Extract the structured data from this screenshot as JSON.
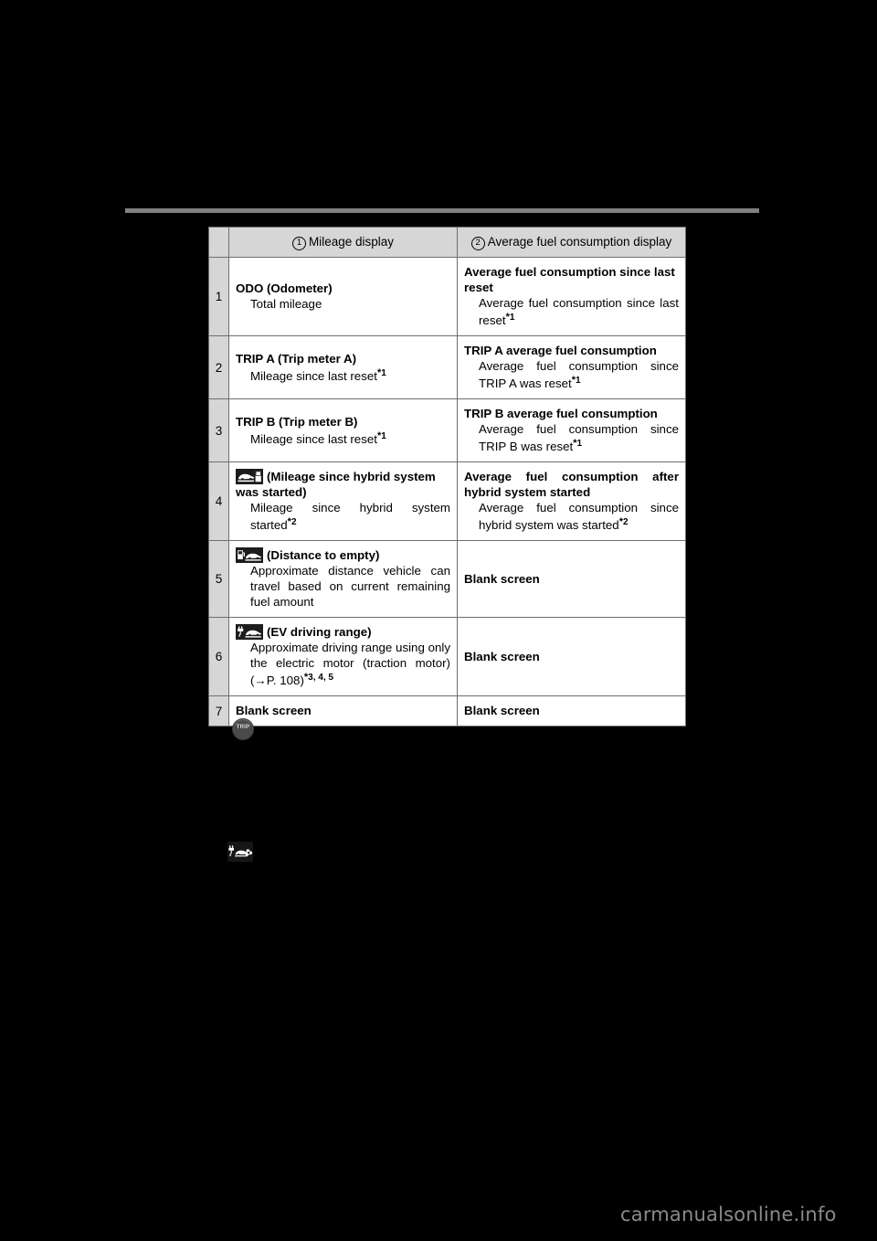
{
  "document": {
    "background_color": "#000000",
    "rule_color": "#808080"
  },
  "table": {
    "header": {
      "index_label": "",
      "col1_marker": "1",
      "col1_label": "Mileage display",
      "col2_marker": "2",
      "col2_label": "Average fuel consumption display"
    },
    "rows": [
      {
        "num": "1",
        "left": {
          "icon": null,
          "title": "ODO (Odometer)",
          "desc": "Total mileage",
          "footnote": ""
        },
        "right": {
          "title": "Average fuel consumption since last reset",
          "desc": "Average fuel consumption since last reset",
          "footnote": "1"
        }
      },
      {
        "num": "2",
        "left": {
          "icon": null,
          "title": "TRIP A (Trip meter A)",
          "desc": "Mileage since last reset",
          "footnote": "1"
        },
        "right": {
          "title": "TRIP A average fuel consumption",
          "desc": "Average fuel consumption since TRIP A was reset",
          "footnote": "1"
        }
      },
      {
        "num": "3",
        "left": {
          "icon": null,
          "title": "TRIP B (Trip meter B)",
          "desc": "Mileage since last reset",
          "footnote": "1"
        },
        "right": {
          "title": "TRIP B average fuel consumption",
          "desc": "Average fuel consumption since TRIP B was reset",
          "footnote": "1"
        }
      },
      {
        "num": "4",
        "left": {
          "icon": "car-mileage-icon",
          "title": "(Mileage since hybrid system was started)",
          "desc": "Mileage since hybrid system started",
          "footnote": "2"
        },
        "right": {
          "title": "Average fuel consumption after hybrid system started",
          "desc": "Average fuel consumption since hybrid system was started",
          "footnote": "2"
        }
      },
      {
        "num": "5",
        "left": {
          "icon": "fuel-pump-car-icon",
          "title": "(Distance to empty)",
          "desc": "Approximate distance vehicle can travel based on current remaining fuel amount",
          "footnote": ""
        },
        "right": {
          "title": "Blank screen",
          "desc": "",
          "footnote": ""
        }
      },
      {
        "num": "6",
        "left": {
          "icon": "ev-plug-car-icon",
          "title": "(EV driving range)",
          "desc": "Approximate driving range using only the electric motor (traction motor) (→P. 108)",
          "footnote": "3, 4, 5"
        },
        "right": {
          "title": "Blank screen",
          "desc": "",
          "footnote": ""
        }
      },
      {
        "num": "7",
        "left": {
          "icon": null,
          "title": "Blank screen",
          "desc": "",
          "footnote": ""
        },
        "right": {
          "title": "Blank screen",
          "desc": "",
          "footnote": ""
        }
      }
    ]
  },
  "icons": {
    "trip_button_label": "TRIP",
    "trip_button_name": "trip-button-icon",
    "ev_pictogram_name": "ev-plug-car-wheel-icon"
  },
  "footer": {
    "watermark": "carmanualsonline.info"
  }
}
